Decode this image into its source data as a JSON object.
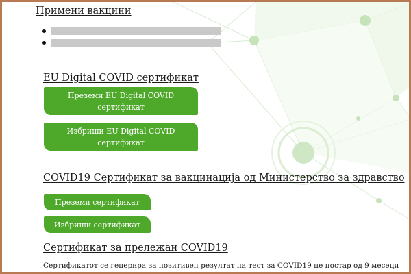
{
  "sections": {
    "vaccines": {
      "heading": "Примени вакцини",
      "items_redacted": 2
    },
    "eu_certificate": {
      "heading": "EU Digital COVID сертификат",
      "download_label": "Преземи EU Digital COVID сертификат",
      "delete_label": "Избриши EU Digital COVID сертификат"
    },
    "ministry_certificate": {
      "heading": "COVID19 Сертификат за вакцинација од Министерство за здравство",
      "download_label": "Преземи сертификат",
      "delete_label": "Избриши сертификат"
    },
    "recovered_certificate": {
      "heading": "Сертификат за прележан COVID19",
      "description": "Сертификатот се генерира за позитивен резултат на тест за COVID19 не постар од 9 месеци"
    }
  },
  "colors": {
    "button": "#4ea92a",
    "button_text": "#ffffff",
    "frame_border": "#b87a52",
    "redaction": "#c9c9c9"
  }
}
